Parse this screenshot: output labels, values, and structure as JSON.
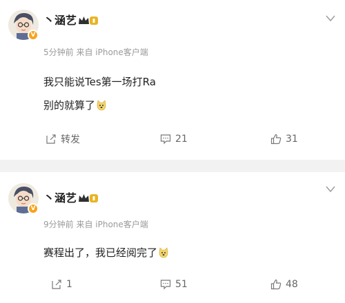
{
  "posts": [
    {
      "username": "丶涵艺",
      "meta": "5分钟前  来自 iPhone客户端",
      "lines": [
        "我只能说Tes第一场打Ra",
        "别的就算了"
      ],
      "actions": {
        "repost": "转发",
        "comment": "21",
        "like": "31"
      }
    },
    {
      "username": "丶涵艺",
      "meta": "9分钟前  来自 iPhone客户端",
      "lines": [
        "赛程出了，我已经阅完了"
      ],
      "actions": {
        "repost": "1",
        "comment": "51",
        "like": "48"
      }
    }
  ],
  "icons": {
    "repost": "repost-icon",
    "comment": "comment-icon",
    "like": "thumbs-up-icon",
    "more": "chevron-down-icon",
    "verified": "verified-badge",
    "member": "crown-member-icon"
  },
  "colors": {
    "verified": "#f7a31b",
    "member_gold": "#e8b422",
    "divider": "#f2f2f2"
  }
}
